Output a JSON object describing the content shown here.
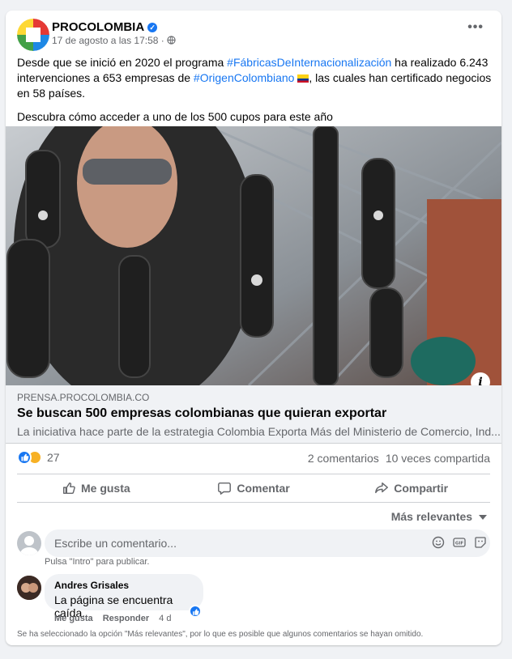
{
  "post": {
    "page_name": "PROCOLOMBIA",
    "date": "17 de agosto a las 17:58",
    "separator": "·",
    "more": "•••",
    "text": {
      "p1_a": "Desde que se inició en 2020 el programa ",
      "hashtag1": "#FábricasDeInternacionalización",
      "p1_b": " ha realizado 6.243 intervenciones a 653 empresas de ",
      "hashtag2": "#OrigenColombiano",
      "p1_c": ", las cuales han certificado negocios en 58 países.",
      "p2": "Descubra cómo acceder a uno de los 500 cupos para este año"
    }
  },
  "link": {
    "domain": "PRENSA.PROCOLOMBIA.CO",
    "title": "Se buscan 500 empresas colombianas que quieran exportar",
    "description": "La iniciativa hace parte de la estrategia Colombia Exporta Más del Ministerio de Comercio, Ind...",
    "info": "i"
  },
  "stats": {
    "reactions_count": "27",
    "comments": "2 comentarios",
    "shares": "10 veces compartida"
  },
  "actions": {
    "like": "Me gusta",
    "comment": "Comentar",
    "share": "Compartir"
  },
  "comments": {
    "sort": "Más relevantes",
    "input_placeholder": "Escribe un comentario...",
    "hint": "Pulsa \"Intro\" para publicar.",
    "items": [
      {
        "author": "Andres Grisales",
        "text": "La página se encuentra caída.",
        "like": "Me gusta",
        "reply": "Responder",
        "age": "4 d"
      }
    ],
    "footnote": "Se ha seleccionado la opción \"Más relevantes\", por lo que es posible que algunos comentarios se hayan omitido."
  },
  "colors": {
    "accent": "#1877f2",
    "text_secondary": "#65676b",
    "background": "#f0f2f5"
  },
  "icons": [
    "procolombia-logo",
    "verified-icon",
    "globe-icon",
    "more-icon",
    "info-icon",
    "like-reaction-icon",
    "love-reaction-icon",
    "like-icon",
    "comment-icon",
    "share-icon",
    "chevron-down-icon",
    "emoji-icon",
    "gif-icon",
    "sticker-icon"
  ]
}
